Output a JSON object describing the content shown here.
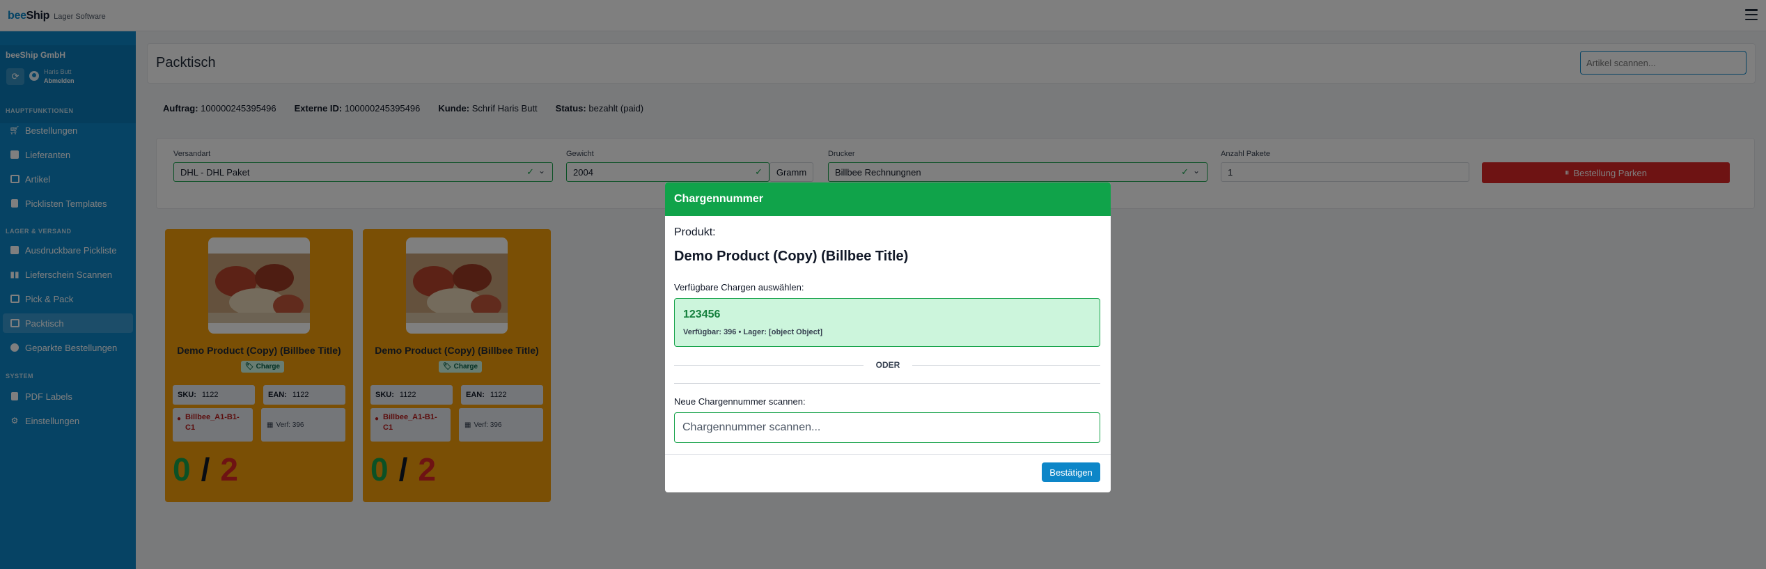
{
  "app": {
    "brand_part1": "bee",
    "brand_part2": "Ship",
    "brand_subtitle": "Lager Software",
    "menu_icon": "hamburger-icon"
  },
  "sidebar": {
    "company": "beeShip GmbH",
    "user_name": "Haris Butt",
    "logout_label": "Abmelden",
    "sections": {
      "main": "HAUPTFUNKTIONEN",
      "warehouse": "LAGER & VERSAND",
      "system": "SYSTEM"
    },
    "items": [
      {
        "label": "Bestellungen",
        "icon": "cart-icon"
      },
      {
        "label": "Lieferanten",
        "icon": "truck-icon"
      },
      {
        "label": "Artikel",
        "icon": "boxes-icon"
      },
      {
        "label": "Picklisten Templates",
        "icon": "document-icon"
      },
      {
        "label": "Ausdruckbare Pickliste",
        "icon": "printer-icon"
      },
      {
        "label": "Lieferschein Scannen",
        "icon": "barcode-icon"
      },
      {
        "label": "Pick & Pack",
        "icon": "box-icon"
      },
      {
        "label": "Packtisch",
        "icon": "table-icon",
        "active": true
      },
      {
        "label": "Geparkte Bestellungen",
        "icon": "parking-icon"
      },
      {
        "label": "PDF Labels",
        "icon": "pdf-icon"
      },
      {
        "label": "Einstellungen",
        "icon": "gear-icon"
      }
    ]
  },
  "page": {
    "title": "Packtisch",
    "scan_placeholder": "Artikel scannen..."
  },
  "order_info": {
    "order_label": "Auftrag:",
    "order_value": "100000245395496",
    "external_label": "Externe ID:",
    "external_value": "100000245395496",
    "customer_label": "Kunde:",
    "customer_value": "Schrif Haris Butt",
    "status_label": "Status:",
    "status_value": "bezahlt (paid)"
  },
  "form": {
    "shipping_label": "Versandart",
    "shipping_value": "DHL - DHL Paket",
    "weight_label": "Gewicht",
    "weight_value": "2004",
    "weight_unit": "Gramm",
    "printer_label": "Drucker",
    "printer_value": "Billbee Rechnungnen",
    "packages_label": "Anzahl Pakete",
    "packages_value": "1",
    "park_button": "Bestellung Parken"
  },
  "products": [
    {
      "title": "Demo Product (Copy) (Billbee Title)",
      "badge": "Charge",
      "sku_label": "SKU:",
      "sku": "1122",
      "ean_label": "EAN:",
      "ean": "1122",
      "location": "Billbee_A1-B1-C1",
      "stock": "Verf: 396",
      "picked": "0",
      "separator": "/",
      "total": "2"
    },
    {
      "title": "Demo Product (Copy) (Billbee Title)",
      "badge": "Charge",
      "sku_label": "SKU:",
      "sku": "1122",
      "ean_label": "EAN:",
      "ean": "1122",
      "location": "Billbee_A1-B1-C1",
      "stock": "Verf: 396",
      "picked": "0",
      "separator": "/",
      "total": "2"
    }
  ],
  "modal": {
    "title": "Chargennummer",
    "product_label": "Produkt:",
    "product_name": "Demo Product (Copy) (Billbee Title)",
    "available_label": "Verfügbare Chargen auswählen:",
    "batch_number": "123456",
    "batch_meta": "Verfügbar: 396 • Lager: [object Object]",
    "or_label": "ODER",
    "new_label": "Neue Chargennummer scannen:",
    "input_placeholder": "Chargennummer scannen...",
    "confirm_button": "Bestätigen"
  },
  "colors": {
    "brand_blue": "#0d86c8",
    "success_green": "#10a34a",
    "danger_red": "#dc2626",
    "card_orange": "#f59e0b"
  }
}
